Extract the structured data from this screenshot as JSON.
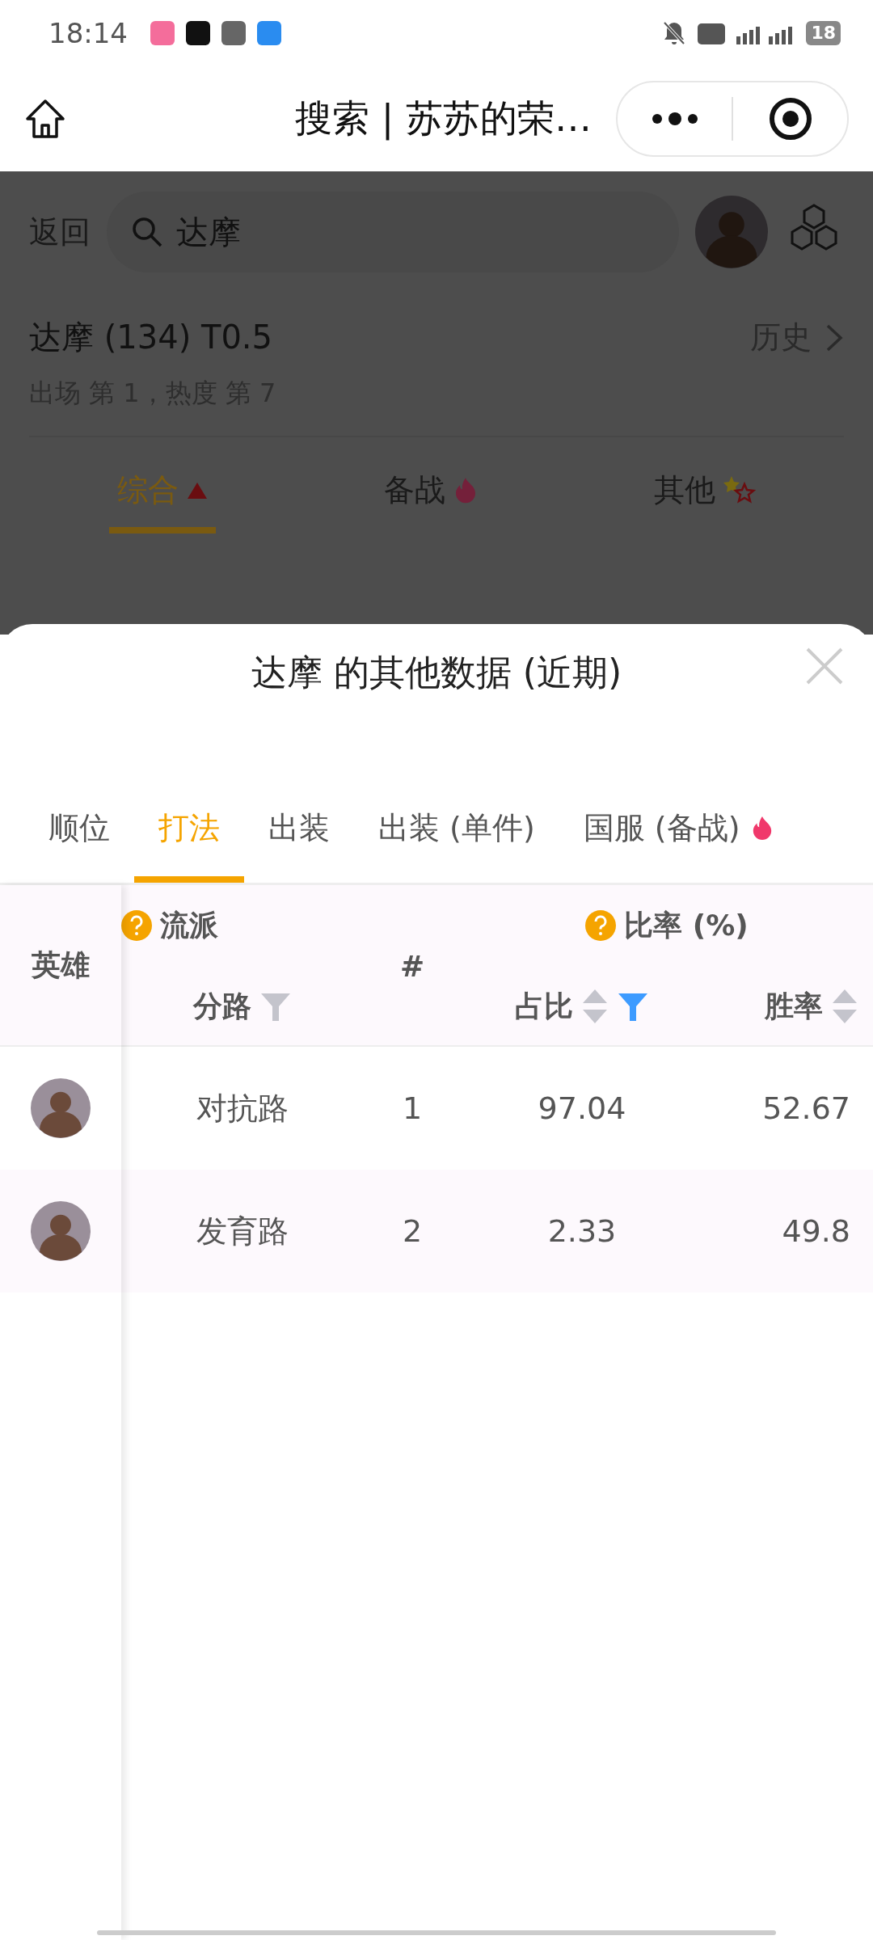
{
  "status_bar": {
    "time": "18:14",
    "battery": "18"
  },
  "nav": {
    "title": "搜索 | 苏苏的荣…"
  },
  "background": {
    "back": "返回",
    "search_value": "达摩",
    "hero_title": "达摩 (134) T0.5",
    "history": "历史",
    "subtitle": "出场 第 1，热度 第 7",
    "tabs": [
      {
        "label": "综合",
        "selected": true,
        "kind": "up"
      },
      {
        "label": "备战",
        "selected": false,
        "kind": "fire"
      },
      {
        "label": "其他",
        "selected": false,
        "kind": "stars"
      }
    ]
  },
  "sheet": {
    "title": "达摩 的其他数据 (近期)",
    "tabs": [
      {
        "label": "顺位",
        "selected": false,
        "hot": false
      },
      {
        "label": "打法",
        "selected": true,
        "hot": false
      },
      {
        "label": "出装",
        "selected": false,
        "hot": false
      },
      {
        "label": "出装 (单件)",
        "selected": false,
        "hot": false
      },
      {
        "label": "国服 (备战)",
        "selected": false,
        "hot": true
      }
    ],
    "table": {
      "group_headers": [
        "流派",
        "比率 (%)"
      ],
      "columns": [
        {
          "label": "英雄"
        },
        {
          "label": "分路",
          "filter_active": false
        },
        {
          "label": "#"
        },
        {
          "label": "占比",
          "sortable": true,
          "filter_active": true
        },
        {
          "label": "胜率",
          "sortable": true
        }
      ],
      "rows": [
        {
          "lane": "对抗路",
          "rank": "1",
          "share": "97.04",
          "win": "52.67"
        },
        {
          "lane": "发育路",
          "rank": "2",
          "share": "2.33",
          "win": "49.8"
        }
      ]
    }
  }
}
